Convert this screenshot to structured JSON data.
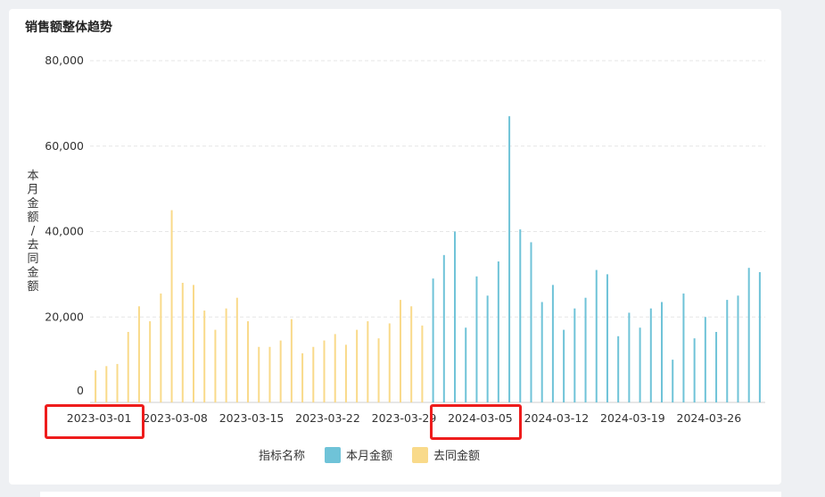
{
  "chart_data": {
    "type": "bar",
    "title": "销售额整体趋势",
    "ylabel": "本月金额/去同金额",
    "ylim": [
      0,
      80000
    ],
    "yticks": [
      "0",
      "20,000",
      "40,000",
      "60,000",
      "80,000"
    ],
    "ytick_values": [
      0,
      20000,
      40000,
      60000,
      80000
    ],
    "xtick_labels": [
      "2023-03-01",
      "2023-03-08",
      "2023-03-15",
      "2023-03-22",
      "2023-03-29",
      "2024-03-05",
      "2024-03-12",
      "2024-03-19",
      "2024-03-26"
    ],
    "xtick_index": [
      0,
      7,
      14,
      21,
      28,
      35,
      42,
      49,
      56
    ],
    "legend": {
      "title": "指标名称"
    },
    "series": [
      {
        "name": "本月金额",
        "color": "#6fc3d8",
        "start_index": 31,
        "values": [
          29000,
          34500,
          40000,
          17500,
          29500,
          25000,
          33000,
          67000,
          40500,
          37500,
          23500,
          27500,
          17000,
          22000,
          24500,
          31000,
          30000,
          15500,
          21000,
          17500,
          22000,
          23500,
          10000,
          25500,
          15000,
          20000,
          16500,
          24000,
          25000,
          31500,
          30500
        ]
      },
      {
        "name": "去同金额",
        "color": "#f9da8a",
        "start_index": 0,
        "values": [
          7500,
          8500,
          9000,
          16500,
          22500,
          19000,
          25500,
          45000,
          28000,
          27500,
          21500,
          17000,
          22000,
          24500,
          19000,
          13000,
          13000,
          14500,
          19500,
          11500,
          13000,
          14500,
          16000,
          13500,
          17000,
          19000,
          15000,
          18500,
          24000,
          22500,
          18000
        ]
      }
    ],
    "highlighted_labels": [
      "2023-03-01",
      "2024-03-05"
    ]
  }
}
